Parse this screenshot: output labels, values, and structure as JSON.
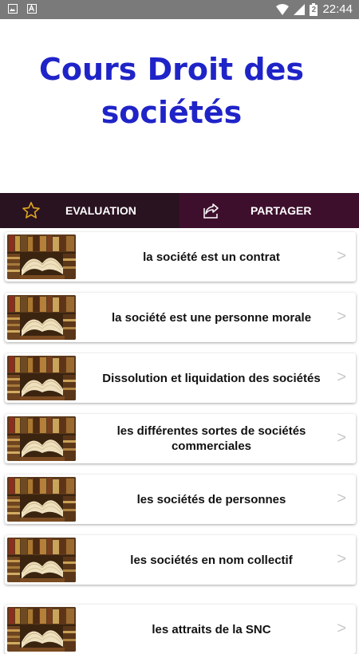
{
  "status_bar": {
    "time": "22:44",
    "battery_level": "2",
    "icons": [
      "image-icon",
      "text-icon",
      "wifi-icon",
      "signal-icon",
      "battery-icon"
    ]
  },
  "header": {
    "title_line1": "Cours Droit des",
    "title_line2": "sociétés",
    "title_color": "#1f24c8"
  },
  "actions": {
    "evaluation": {
      "label": "EVALUATION",
      "icon": "star-outline-icon"
    },
    "share": {
      "label": "PARTAGER",
      "icon": "share-icon"
    }
  },
  "list": {
    "chevron": ">",
    "items": [
      {
        "label": "la société est un contrat"
      },
      {
        "label": "la société est une personne morale"
      },
      {
        "label": "Dissolution et liquidation des sociétés"
      },
      {
        "label": "les différentes sortes de sociétés commerciales"
      },
      {
        "label": "les sociétés de personnes"
      },
      {
        "label": "les sociétés en nom collectif"
      },
      {
        "label": "les attraits de la SNC"
      }
    ]
  },
  "colors": {
    "action_eval_bg": "#2a1321",
    "action_share_bg": "#3e0f2d",
    "status_bar_bg": "#7a7a7a"
  }
}
